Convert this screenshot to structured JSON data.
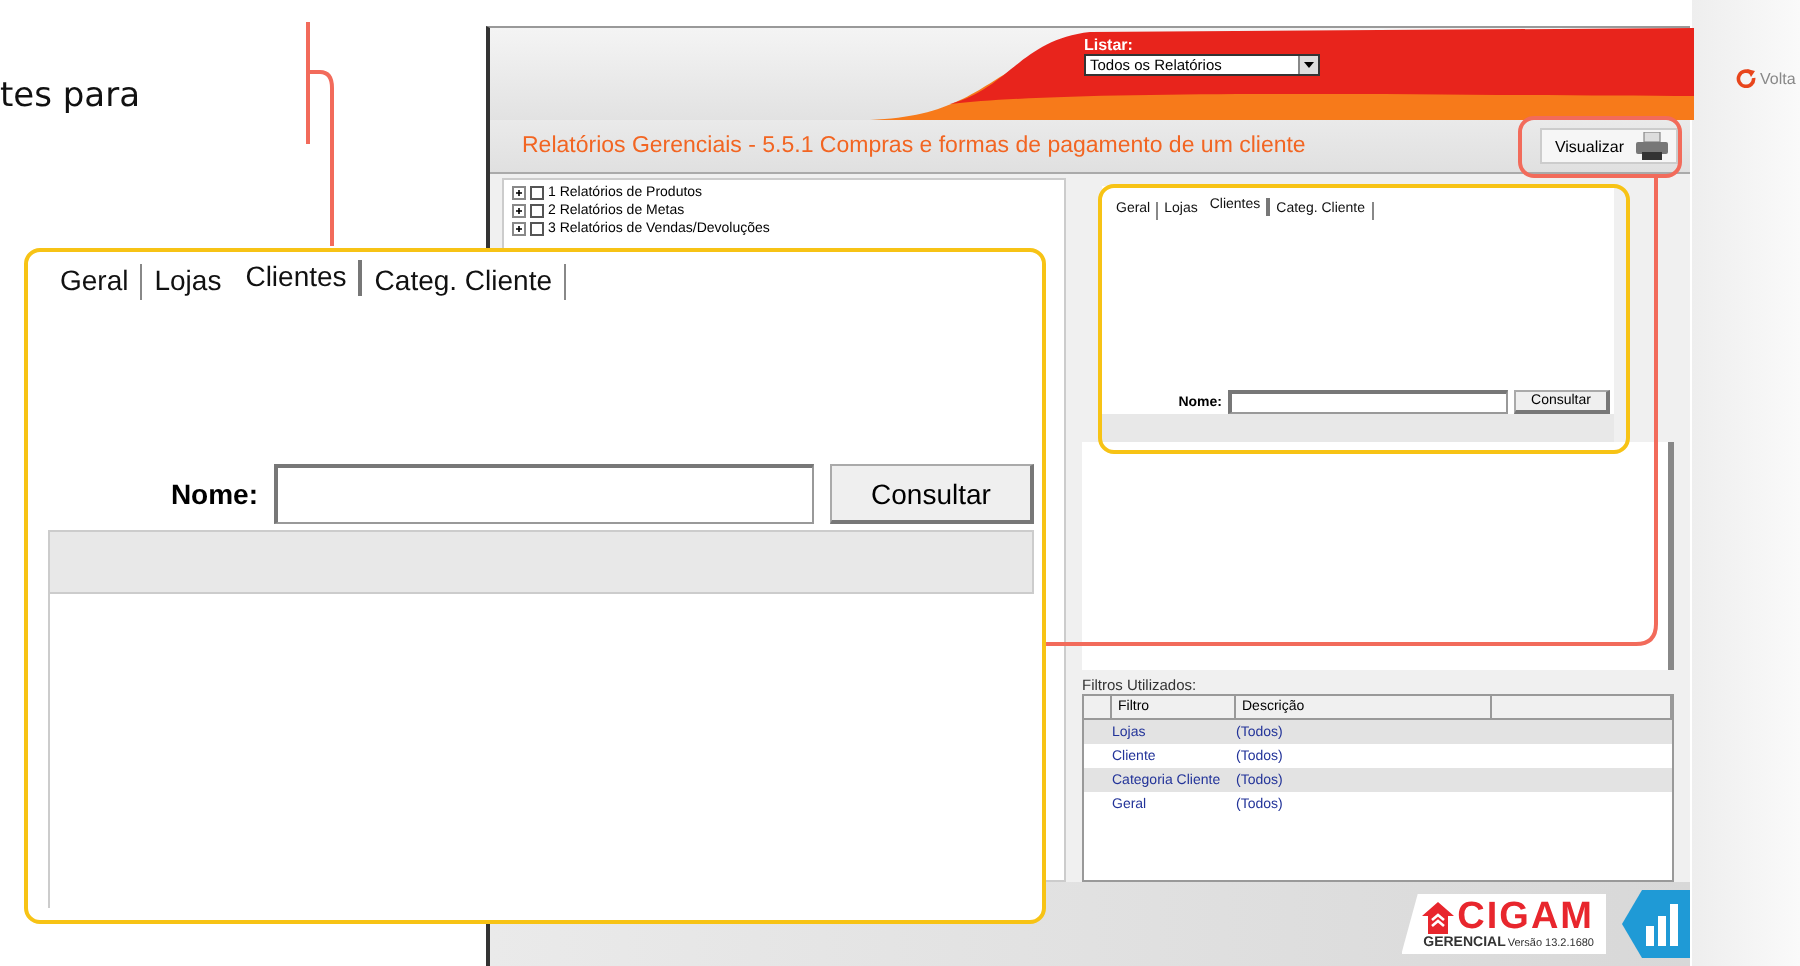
{
  "doc_text": "tes para",
  "back_link": {
    "label": "Volta"
  },
  "app": {
    "list_label": "Listar:",
    "list_value": "Todos os Relatórios",
    "title": "Relatórios Gerenciais - 5.5.1 Compras e formas de pagamento de um cliente",
    "preview_button": "Visualizar",
    "tree": [
      {
        "label": "1 Relatórios de Produtos",
        "checked": false,
        "expanded": false
      },
      {
        "label": "2 Relatórios de Metas",
        "checked": false,
        "expanded": false
      },
      {
        "label": "3 Relatórios de Vendas/Devoluções",
        "checked": false,
        "expanded": false
      }
    ],
    "tabs": [
      {
        "label": "Geral",
        "selected": false
      },
      {
        "label": "Lojas",
        "selected": false
      },
      {
        "label": "Clientes",
        "selected": true
      },
      {
        "label": "Categ. Cliente",
        "selected": false
      }
    ],
    "name_label": "Nome:",
    "search_button": "Consultar",
    "filters": {
      "title": "Filtros Utilizados:",
      "columns": [
        "Filtro",
        "Descrição"
      ],
      "rows": [
        {
          "filter": "Lojas",
          "description": "(Todos)"
        },
        {
          "filter": "Cliente",
          "description": "(Todos)"
        },
        {
          "filter": "Categoria Cliente",
          "description": "(Todos)"
        },
        {
          "filter": "Geral",
          "description": "(Todos)"
        }
      ]
    },
    "brand": "CIGAM",
    "brand_sub": "GERENCIAL",
    "version": "Versão 13.2.1680"
  },
  "callout": {
    "tabs": [
      {
        "label": "Geral",
        "selected": false
      },
      {
        "label": "Lojas",
        "selected": false
      },
      {
        "label": "Clientes",
        "selected": true
      },
      {
        "label": "Categ. Cliente",
        "selected": false
      }
    ],
    "name_label": "Nome:",
    "search_button": "Consultar"
  }
}
